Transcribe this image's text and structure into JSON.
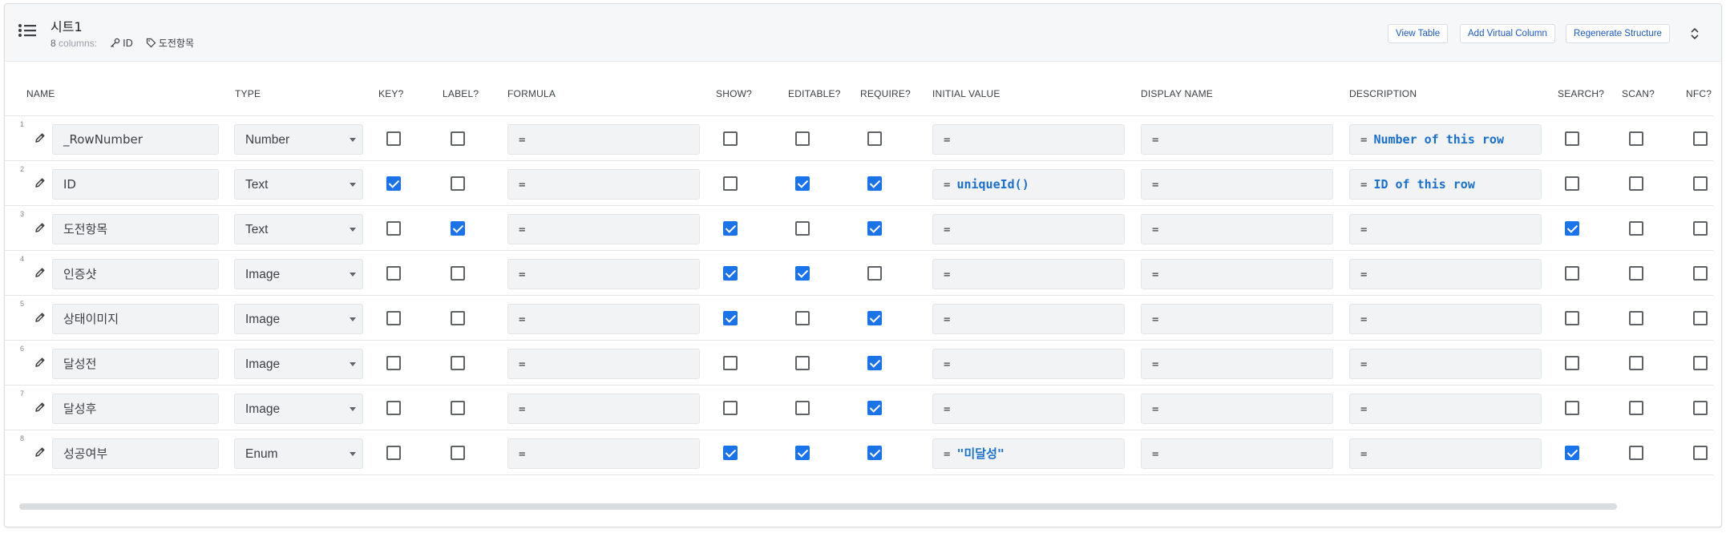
{
  "sheet": {
    "title": "시트1",
    "columns_count": "8",
    "columns_suffix": "columns:",
    "key_tag": "ID",
    "label_tag": "도전항목"
  },
  "buttons": {
    "view_table": "View Table",
    "add_virtual_column": "Add Virtual Column",
    "regenerate_structure": "Regenerate Structure"
  },
  "headers": {
    "name": "NAME",
    "type": "TYPE",
    "key": "KEY?",
    "label": "LABEL?",
    "formula": "FORMULA",
    "show": "SHOW?",
    "editable": "EDITABLE?",
    "require": "REQUIRE?",
    "initial_value": "INITIAL VALUE",
    "display_name": "DISPLAY NAME",
    "description": "DESCRIPTION",
    "search": "SEARCH?",
    "scan": "SCAN?",
    "nfc": "NFC?"
  },
  "rows": [
    {
      "num": "1",
      "name": "_RowNumber",
      "type": "Number",
      "key": false,
      "label": false,
      "formula": "=",
      "show": false,
      "editable": false,
      "require": false,
      "initial_eq": "=",
      "initial_expr": "",
      "display": "=",
      "desc_eq": "=",
      "desc_expr": "Number of this row",
      "search": false,
      "scan": false,
      "nfc": false
    },
    {
      "num": "2",
      "name": "ID",
      "type": "Text",
      "key": true,
      "label": false,
      "formula": "=",
      "show": false,
      "editable": true,
      "require": true,
      "initial_eq": "=",
      "initial_expr": "uniqueId()",
      "display": "=",
      "desc_eq": "=",
      "desc_expr": "ID of this row",
      "search": false,
      "scan": false,
      "nfc": false
    },
    {
      "num": "3",
      "name": "도전항목",
      "type": "Text",
      "key": false,
      "label": true,
      "formula": "=",
      "show": true,
      "editable": false,
      "require": true,
      "initial_eq": "=",
      "initial_expr": "",
      "display": "=",
      "desc_eq": "=",
      "desc_expr": "",
      "search": true,
      "scan": false,
      "nfc": false
    },
    {
      "num": "4",
      "name": "인증샷",
      "type": "Image",
      "key": false,
      "label": false,
      "formula": "=",
      "show": true,
      "editable": true,
      "require": false,
      "initial_eq": "=",
      "initial_expr": "",
      "display": "=",
      "desc_eq": "=",
      "desc_expr": "",
      "search": false,
      "scan": false,
      "nfc": false
    },
    {
      "num": "5",
      "name": "상태이미지",
      "type": "Image",
      "key": false,
      "label": false,
      "formula": "=",
      "show": true,
      "editable": false,
      "require": true,
      "initial_eq": "=",
      "initial_expr": "",
      "display": "=",
      "desc_eq": "=",
      "desc_expr": "",
      "search": false,
      "scan": false,
      "nfc": false
    },
    {
      "num": "6",
      "name": "달성전",
      "type": "Image",
      "key": false,
      "label": false,
      "formula": "=",
      "show": false,
      "editable": false,
      "require": true,
      "initial_eq": "=",
      "initial_expr": "",
      "display": "=",
      "desc_eq": "=",
      "desc_expr": "",
      "search": false,
      "scan": false,
      "nfc": false
    },
    {
      "num": "7",
      "name": "달성후",
      "type": "Image",
      "key": false,
      "label": false,
      "formula": "=",
      "show": false,
      "editable": false,
      "require": true,
      "initial_eq": "=",
      "initial_expr": "",
      "display": "=",
      "desc_eq": "=",
      "desc_expr": "",
      "search": false,
      "scan": false,
      "nfc": false
    },
    {
      "num": "8",
      "name": "성공여부",
      "type": "Enum",
      "key": false,
      "label": false,
      "formula": "=",
      "show": true,
      "editable": true,
      "require": true,
      "initial_eq": "=",
      "initial_expr": "\"미달성\"",
      "display": "=",
      "desc_eq": "=",
      "desc_expr": "",
      "search": true,
      "scan": false,
      "nfc": false
    }
  ],
  "colors": {
    "accent": "#1a73e8",
    "link": "#1a57c7",
    "expr": "#1a6fd1"
  }
}
